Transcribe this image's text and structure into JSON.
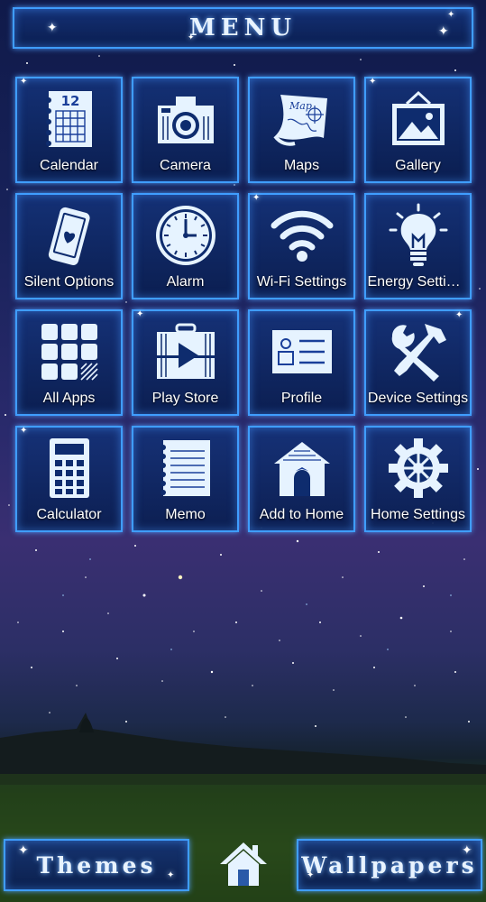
{
  "header": {
    "title": "MENU"
  },
  "tiles": [
    {
      "label": "Calendar",
      "icon": "calendar-icon",
      "calendar_day": "12"
    },
    {
      "label": "Camera",
      "icon": "camera-icon"
    },
    {
      "label": "Maps",
      "icon": "map-icon",
      "map_text": "Map"
    },
    {
      "label": "Gallery",
      "icon": "gallery-icon"
    },
    {
      "label": "Silent Options",
      "icon": "phone-heart-icon"
    },
    {
      "label": "Alarm",
      "icon": "clock-icon"
    },
    {
      "label": "Wi-Fi Settings",
      "icon": "wifi-icon"
    },
    {
      "label": "Energy Settings",
      "icon": "lightbulb-icon"
    },
    {
      "label": "All Apps",
      "icon": "app-grid-icon"
    },
    {
      "label": "Play Store",
      "icon": "play-store-icon"
    },
    {
      "label": "Profile",
      "icon": "profile-card-icon"
    },
    {
      "label": "Device Settings",
      "icon": "tools-icon"
    },
    {
      "label": "Calculator",
      "icon": "calculator-icon"
    },
    {
      "label": "Memo",
      "icon": "memo-icon"
    },
    {
      "label": "Add to Home",
      "icon": "house-icon"
    },
    {
      "label": "Home Settings",
      "icon": "gear-icon"
    }
  ],
  "bottom": {
    "themes_label": "Themes",
    "wallpapers_label": "Wallpapers",
    "home_icon": "home-icon"
  },
  "colors": {
    "accent": "#3f9dff",
    "tile_bg": "#0e2c6e",
    "icon": "#e6f3ff"
  }
}
